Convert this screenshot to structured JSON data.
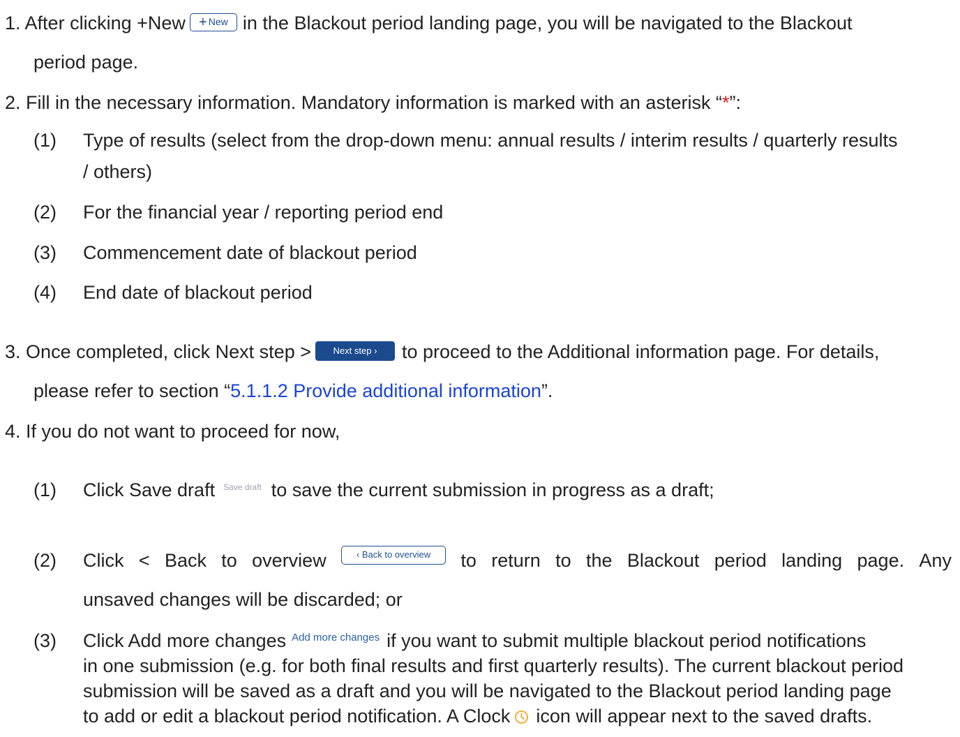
{
  "step1": {
    "num": "1.",
    "before": "After clicking +New",
    "new_button_label": "New",
    "new_button_plus": "+",
    "after": "in the Blackout period landing page, you will be navigated to the Blackout",
    "cont": "period page."
  },
  "step2": {
    "num": "2.",
    "before": "Fill in the necessary information. Mandatory information is marked with an asterisk “",
    "asterisk": "*",
    "after": "”:",
    "items": [
      {
        "num": "(1)",
        "text": "Type of results (select from the drop-down menu: annual results / interim results / quarterly results",
        "cont": "/ others)"
      },
      {
        "num": "(2)",
        "text": "For the financial year / reporting period end"
      },
      {
        "num": "(3)",
        "text": "Commencement date of blackout period"
      },
      {
        "num": "(4)",
        "text": "End date of blackout period"
      }
    ]
  },
  "step3": {
    "num": "3.",
    "before": "Once completed, click Next step >",
    "next_button_label": "Next step ›",
    "after": "to proceed to the Additional information page. For details,",
    "cont_before": "please refer to section “",
    "link_text": "5.1.1.2 Provide additional information",
    "cont_after": "”."
  },
  "step4": {
    "num": "4.",
    "text": "If you do not want to proceed for now,",
    "item1": {
      "num": "(1)",
      "before": "Click Save draft",
      "save_button_label": "Save draft",
      "after": "to save the current submission in progress as a draft;"
    },
    "item2": {
      "num": "(2)",
      "words": [
        "Click",
        "<",
        "Back",
        "to",
        "overview"
      ],
      "back_button_label": "‹  Back to overview",
      "words_after": [
        "to",
        "return",
        "to",
        "the",
        "Blackout",
        "period",
        "landing",
        "page.",
        "Any"
      ],
      "cont": "unsaved changes will be discarded; or"
    },
    "item3": {
      "num": "(3)",
      "before": "Click Add more changes",
      "addmore_label": "Add more changes",
      "after": "if you want to submit multiple blackout period notifications",
      "line2": "in one submission (e.g. for both final results and first quarterly results). The current blackout period",
      "line3": "submission will be saved as a draft and you will be navigated to the Blackout period landing page",
      "line4_before": "to add or edit a blackout period notification. A Clock",
      "line4_after": "icon will appear next to the saved drafts."
    }
  },
  "colors": {
    "text": "#222222",
    "asterisk": "#e0191b",
    "link": "#1a44d6",
    "primary_button": "#1b4a8d",
    "clock_icon": "#f5a623"
  }
}
